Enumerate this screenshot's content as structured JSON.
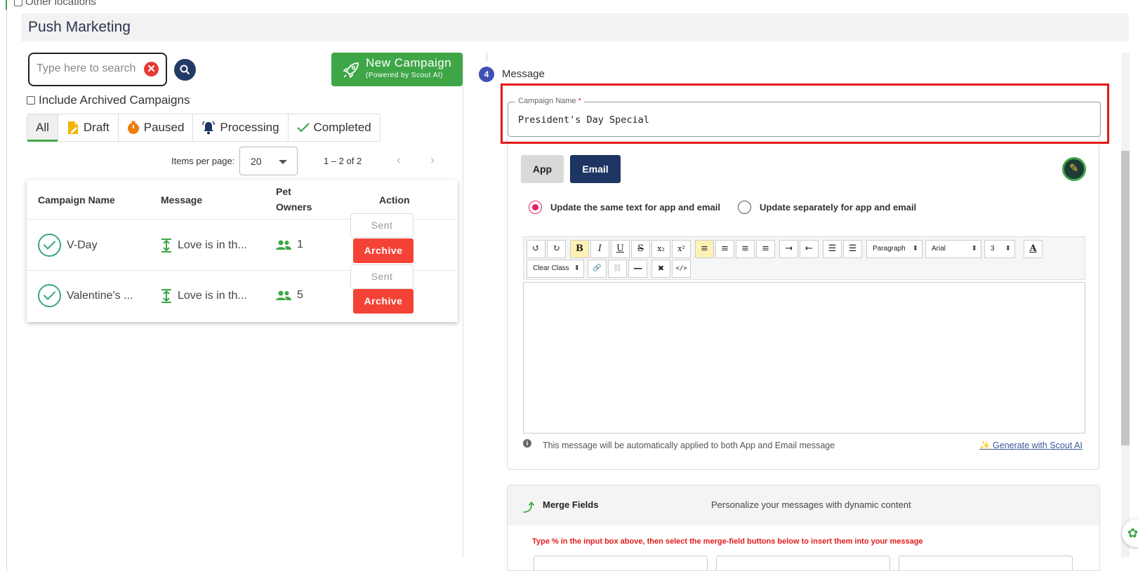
{
  "top": {
    "other_locations": "Other locations"
  },
  "page": {
    "title": "Push Marketing"
  },
  "search": {
    "placeholder": "Type here to search",
    "clear_glyph": "✕"
  },
  "new_campaign": {
    "label": "New Campaign",
    "sub": "(Powered by Scout AI)"
  },
  "archived_filter": {
    "label": "Include Archived Campaigns"
  },
  "tabs": [
    {
      "label": "All",
      "icon": "none"
    },
    {
      "label": "Draft",
      "icon": "draft-icon"
    },
    {
      "label": "Paused",
      "icon": "timer-icon"
    },
    {
      "label": "Processing",
      "icon": "bell-icon"
    },
    {
      "label": "Completed",
      "icon": "check-icon"
    }
  ],
  "pager": {
    "label": "Items per page:",
    "size": "20",
    "range": "1 – 2 of 2",
    "prev": "‹",
    "next": "›"
  },
  "table": {
    "headers": {
      "name": "Campaign Name",
      "message": "Message",
      "owners_1": "Pet",
      "owners_2": "Owners",
      "action": "Action"
    },
    "rows": [
      {
        "name": "V-Day",
        "message": "Love is in th...",
        "owners": "1",
        "status": "Sent",
        "action": "Archive"
      },
      {
        "name": "Valentine's ...",
        "message": "Love is in th...",
        "owners": "5",
        "status": "Sent",
        "action": "Archive"
      }
    ]
  },
  "step": {
    "number": "4",
    "label": "Message"
  },
  "campaign_name": {
    "label": "Campaign Name",
    "required": "*",
    "value": "President's Day Special"
  },
  "channel": {
    "app": "App",
    "email": "Email"
  },
  "mode": {
    "same": "Update the same text for app and email",
    "separate": "Update separately for app and email"
  },
  "toolbar": {
    "undo": "↺",
    "redo": "↻",
    "bold": "B",
    "italic": "I",
    "underline": "U",
    "strike": "S",
    "sub": "x₂",
    "sup": "x²",
    "align_left": "≡",
    "align_center": "≡",
    "align_right": "≡",
    "justify": "≡",
    "indent": "⇥",
    "outdent": "⇤",
    "ul": "☰",
    "ol": "☰",
    "block": "Paragraph",
    "font": "Arial",
    "size": "3",
    "color": "A",
    "clear_class": "Clear Class",
    "link": "🔗",
    "unlink": "⛓",
    "hr": "—",
    "remove": "✖",
    "code": "</>"
  },
  "editor": {
    "info": "This message will be automatically applied to both App and Email message",
    "generate": "✨ Generate with Scout AI"
  },
  "merge": {
    "icon": "⤴",
    "title": "Merge Fields",
    "desc": "Personalize your messages with dynamic content",
    "hint": "Type % in the input box above, then select the merge-field buttons below to insert them into your message"
  },
  "colors": {
    "accent_green": "#3fa648",
    "navy": "#1e3563",
    "danger": "#f44336",
    "highlight_red": "#e21a1a",
    "step_blue": "#3f51b5"
  }
}
